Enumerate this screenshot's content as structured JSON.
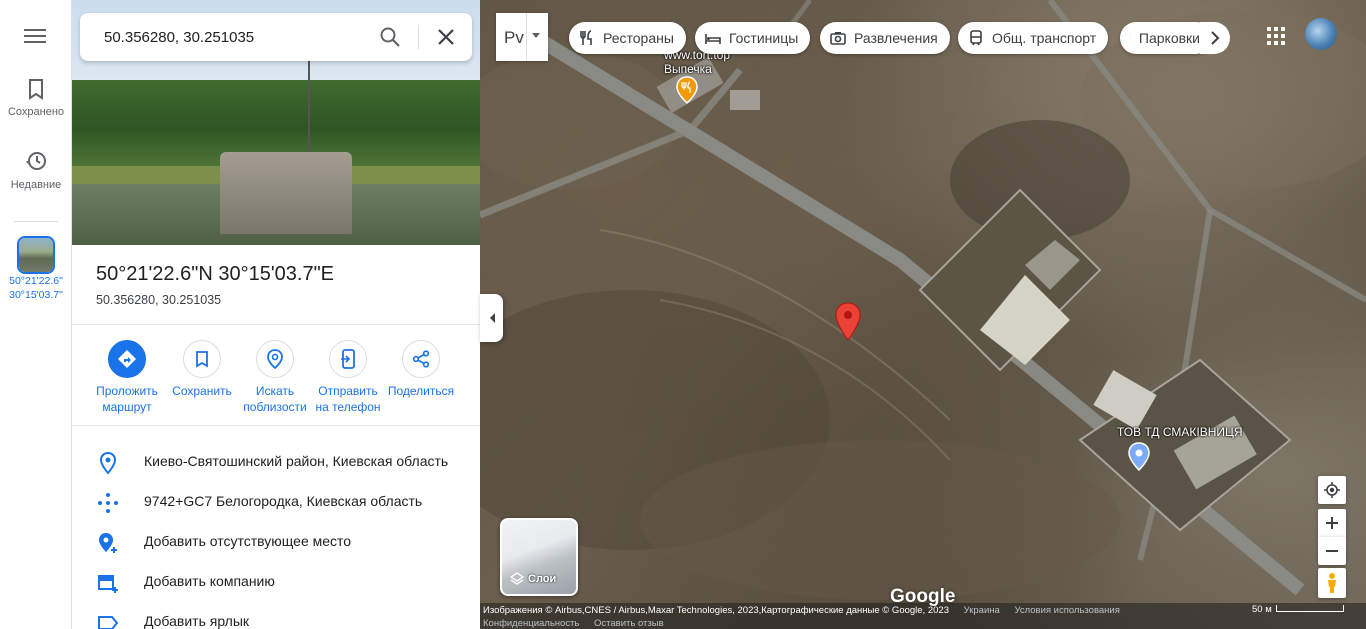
{
  "rail": {
    "saved_label": "Сохранено",
    "recent_label": "Недавние",
    "recent_place": {
      "coord_line1": "50°21'22.6\"",
      "coord_line2": "30°15'03.7\""
    }
  },
  "search": {
    "value": "50.356280, 30.251035"
  },
  "place": {
    "title": "50°21'22.6\"N 30°15'03.7\"E",
    "subtitle": "50.356280, 30.251035"
  },
  "actions": [
    {
      "label": "Проложить маршрут",
      "icon": "directions-icon"
    },
    {
      "label": "Сохранить",
      "icon": "bookmark-icon"
    },
    {
      "label": "Искать поблизости",
      "icon": "nearby-icon"
    },
    {
      "label": "Отправить на телефон",
      "icon": "send-to-phone-icon"
    },
    {
      "label": "Поделиться",
      "icon": "share-icon"
    }
  ],
  "info_rows": [
    {
      "text": "Киево-Святошинский район, Киевская область",
      "icon": "location-pin-icon"
    },
    {
      "text": "9742+GC7 Белогородка, Киевская область",
      "icon": "plus-code-icon"
    },
    {
      "text": "Добавить отсутствующее место",
      "icon": "add-place-icon"
    },
    {
      "text": "Добавить компанию",
      "icon": "add-business-icon"
    },
    {
      "text": "Добавить ярлык",
      "icon": "label-icon"
    }
  ],
  "map": {
    "view_toggle_label": "Рv",
    "chips": [
      {
        "label": "Рестораны",
        "icon": "restaurant-icon"
      },
      {
        "label": "Гостиницы",
        "icon": "hotel-icon"
      },
      {
        "label": "Развлечения",
        "icon": "camera-icon"
      },
      {
        "label": "Общ. транспорт",
        "icon": "transit-icon"
      },
      {
        "label": "Парковки",
        "icon": "parking-icon"
      }
    ],
    "poi_top_line1": "www.tort.top",
    "poi_top_line2": "Выпечка",
    "poi_business": "ТОВ ТД СМАКІВНИЦЯ",
    "layers_label": "Слои",
    "google_logo": "Google",
    "attribution": "Изображения © Airbus,CNES / Airbus,Maxar Technologies, 2023,Картографические данные © Google, 2023",
    "footer_links": [
      "Украина",
      "Условия использования"
    ],
    "footer_links_row2": [
      "Конфиденциальность",
      "Оставить отзыв"
    ],
    "scale_label": "50 м",
    "colors": {
      "accent": "#1a73e8",
      "pin": "#ea4335",
      "poi_orange": "#f29900"
    }
  }
}
